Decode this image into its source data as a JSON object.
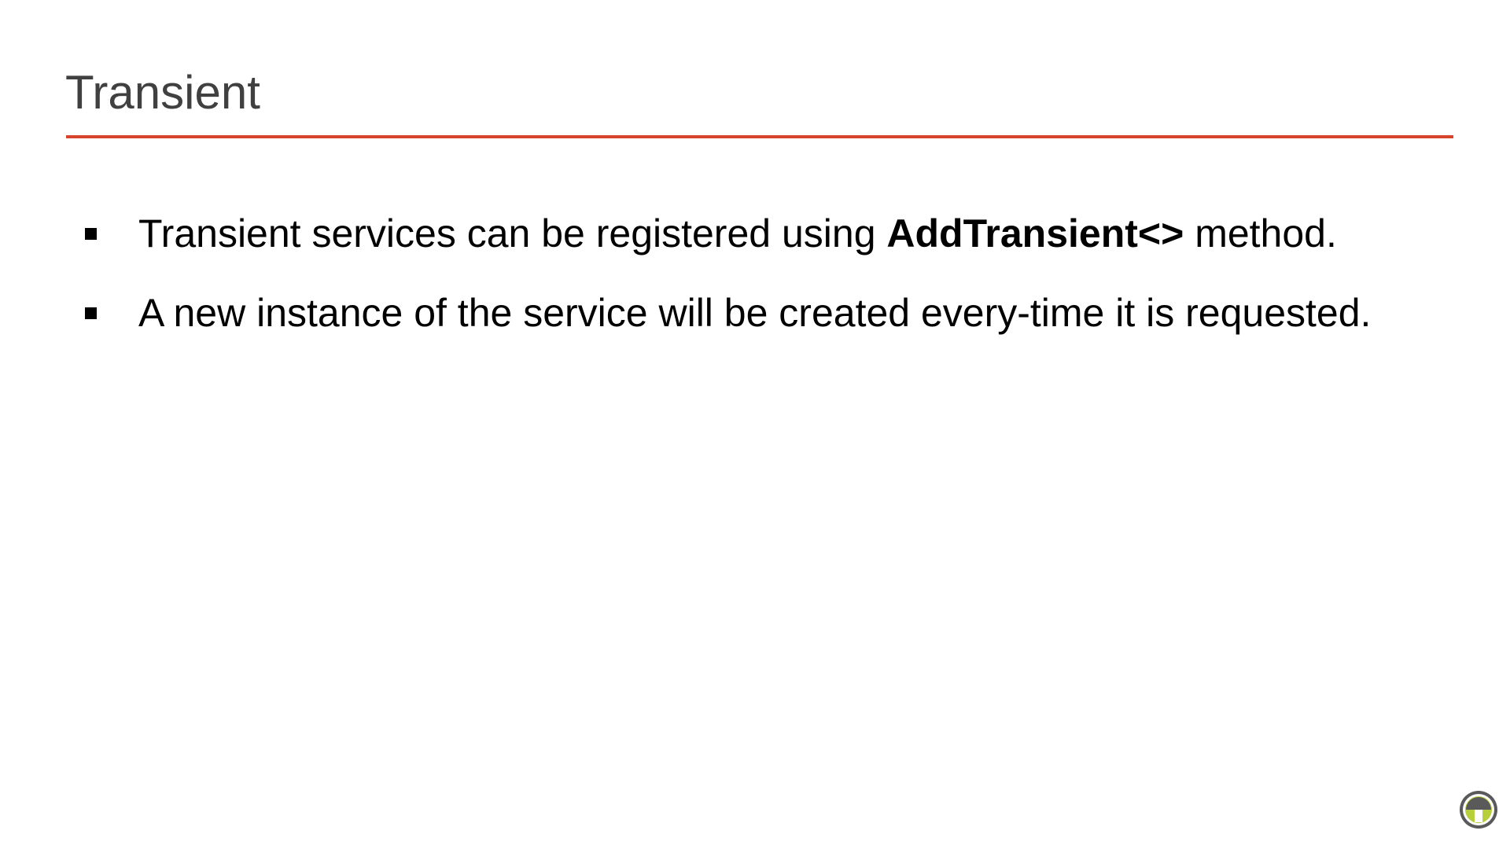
{
  "slide": {
    "title": "Transient",
    "accent_color": "#d5442b",
    "bullets": [
      {
        "before": "Transient services can be registered using ",
        "bold": "AddTransient<>",
        "after": " method."
      },
      {
        "text": "A new instance of the service will be created every-time it is requested."
      }
    ],
    "logo_icon": "circular-g-logo-icon",
    "logo_colors": {
      "ring": "#5a5a5a",
      "accent": "#b7cf3c"
    }
  }
}
